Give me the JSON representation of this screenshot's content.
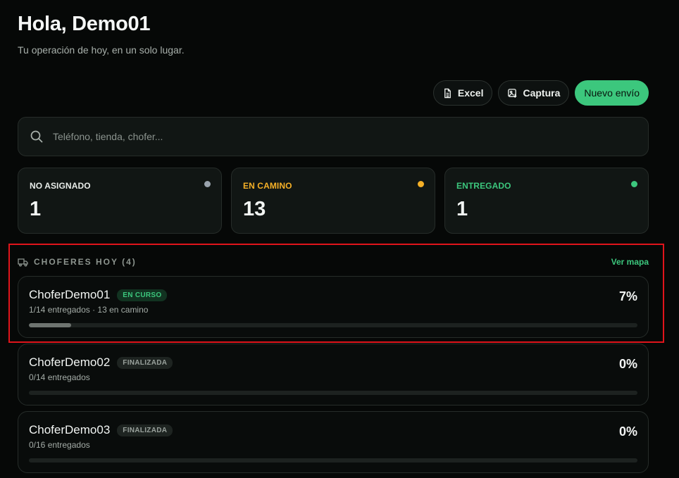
{
  "header": {
    "title": "Hola, Demo01",
    "subtitle": "Tu operación de hoy, en un solo lugar."
  },
  "actions": {
    "excel_label": "Excel",
    "capture_label": "Captura",
    "new_label": "Nuevo envío"
  },
  "search": {
    "placeholder": "Teléfono, tienda, chofer..."
  },
  "stats": [
    {
      "label": "NO ASIGNADO",
      "value": "1",
      "color": "#9aa3ad"
    },
    {
      "label": "EN CAMINO",
      "value": "13",
      "color": "#f5b027"
    },
    {
      "label": "ENTREGADO",
      "value": "1",
      "color": "#3cc77d"
    }
  ],
  "drivers_section": {
    "title": "CHOFERES HOY (4)",
    "map_link": "Ver mapa"
  },
  "drivers": [
    {
      "name": "ChoferDemo01",
      "status": "EN CURSO",
      "meta": "1/14 entregados · 13 en camino",
      "percent": "7%",
      "progress": 0.07
    },
    {
      "name": "ChoferDemo02",
      "status": "FINALIZADA",
      "meta": "0/14 entregados",
      "percent": "0%",
      "progress": 0
    },
    {
      "name": "ChoferDemo03",
      "status": "FINALIZADA",
      "meta": "0/16 entregados",
      "percent": "0%",
      "progress": 0
    }
  ],
  "colors": {
    "accent": "#3cc77d",
    "highlight": "#e0141b",
    "background": "#060807"
  }
}
